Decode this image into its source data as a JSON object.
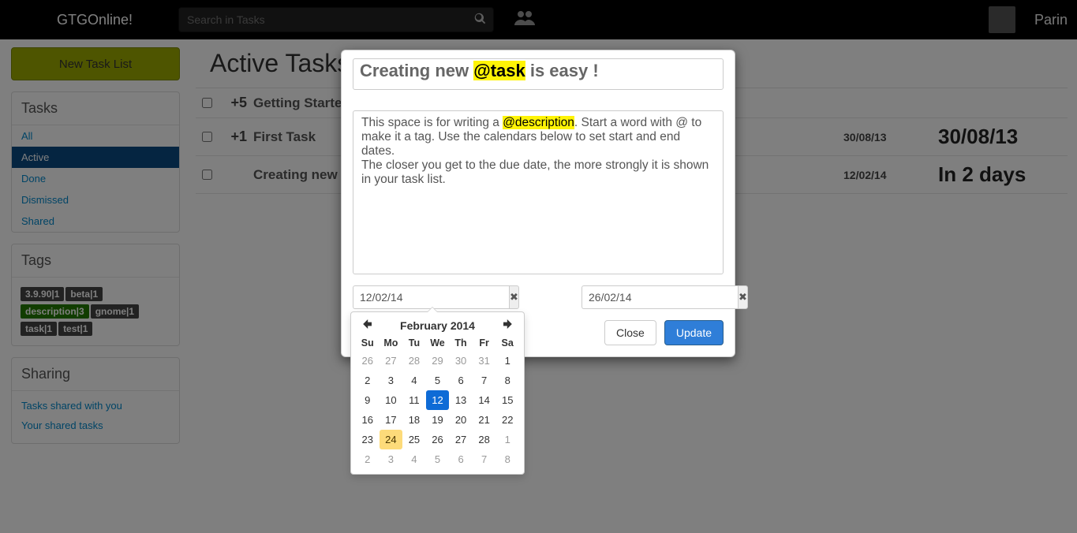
{
  "nav": {
    "brand": "GTGOnline!",
    "search_placeholder": "Search in Tasks",
    "username": "Parin"
  },
  "sidebar": {
    "new_task_label": "New Task List",
    "tasks_heading": "Tasks",
    "filters": [
      "All",
      "Active",
      "Done",
      "Dismissed",
      "Shared"
    ],
    "active_index": 1,
    "tags_heading": "Tags",
    "tags": [
      {
        "label": "3.9.90|1"
      },
      {
        "label": "beta|1"
      },
      {
        "label": "description|3",
        "hl": true
      },
      {
        "label": "gnome|1"
      },
      {
        "label": "task|1"
      },
      {
        "label": "test|1"
      }
    ],
    "sharing_heading": "Sharing",
    "sharing": [
      "Tasks shared with you",
      "Your shared tasks"
    ]
  },
  "main": {
    "heading": "Active Tasks",
    "rows": [
      {
        "count": "+5",
        "title": "Getting Started",
        "d1": "",
        "d2": ""
      },
      {
        "count": "+1",
        "title": "First Task",
        "d1": "30/08/13",
        "d2": "30/08/13",
        "big": true
      },
      {
        "count": "",
        "title": "Creating new @...",
        "d1": "12/02/14",
        "d2": "In 2 days",
        "big": true
      }
    ]
  },
  "modal": {
    "title_pre": "Creating new ",
    "title_tag": "@task",
    "title_post": " is easy !",
    "desc_pre": "This space is for writing a ",
    "desc_tag": "@description",
    "desc_mid": ". Start a word with @ to make it a tag. Use the calendars below to set start and end dates.",
    "desc_line2": "The closer you get to the due date, the more strongly it is shown in your task list.",
    "start_date": "12/02/14",
    "end_date": "26/02/14",
    "close_label": "Close",
    "update_label": "Update"
  },
  "datepicker": {
    "title": "February 2014",
    "dow": [
      "Su",
      "Mo",
      "Tu",
      "We",
      "Th",
      "Fr",
      "Sa"
    ],
    "days": [
      {
        "d": "26",
        "o": true
      },
      {
        "d": "27",
        "o": true
      },
      {
        "d": "28",
        "o": true
      },
      {
        "d": "29",
        "o": true
      },
      {
        "d": "30",
        "o": true
      },
      {
        "d": "31",
        "o": true
      },
      {
        "d": "1"
      },
      {
        "d": "2"
      },
      {
        "d": "3"
      },
      {
        "d": "4"
      },
      {
        "d": "5"
      },
      {
        "d": "6"
      },
      {
        "d": "7"
      },
      {
        "d": "8"
      },
      {
        "d": "9"
      },
      {
        "d": "10"
      },
      {
        "d": "11"
      },
      {
        "d": "12",
        "sel": true
      },
      {
        "d": "13"
      },
      {
        "d": "14"
      },
      {
        "d": "15"
      },
      {
        "d": "16"
      },
      {
        "d": "17"
      },
      {
        "d": "18"
      },
      {
        "d": "19"
      },
      {
        "d": "20"
      },
      {
        "d": "21"
      },
      {
        "d": "22"
      },
      {
        "d": "23"
      },
      {
        "d": "24",
        "today": true
      },
      {
        "d": "25"
      },
      {
        "d": "26"
      },
      {
        "d": "27"
      },
      {
        "d": "28"
      },
      {
        "d": "1",
        "o": true
      },
      {
        "d": "2",
        "o": true
      },
      {
        "d": "3",
        "o": true
      },
      {
        "d": "4",
        "o": true
      },
      {
        "d": "5",
        "o": true
      },
      {
        "d": "6",
        "o": true
      },
      {
        "d": "7",
        "o": true
      },
      {
        "d": "8",
        "o": true
      }
    ]
  }
}
